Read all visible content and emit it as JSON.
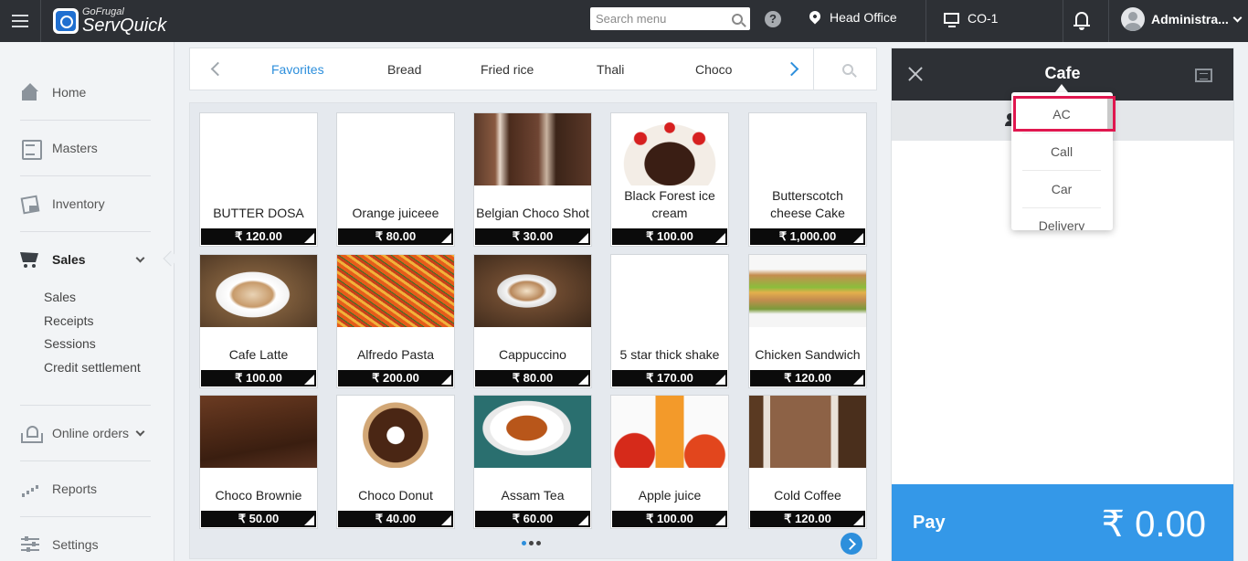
{
  "topbar": {
    "brand_small": "GoFrugal",
    "brand_name": "ServQuick",
    "search_placeholder": "Search menu",
    "help_label": "?",
    "location": "Head Office",
    "counter": "CO-1",
    "user": "Administra..."
  },
  "sidebar": {
    "home": "Home",
    "masters": "Masters",
    "inventory": "Inventory",
    "sales": "Sales",
    "sales_sub": [
      "Sales",
      "Receipts",
      "Sessions",
      "Credit settlement"
    ],
    "online_orders": "Online orders",
    "reports": "Reports",
    "settings": "Settings"
  },
  "categories": [
    "Favorites",
    "Bread",
    "Fried rice",
    "Thali",
    "Choco"
  ],
  "active_category": "Favorites",
  "products": [
    {
      "name": "BUTTER DOSA",
      "price": "₹ 120.00",
      "image": "none"
    },
    {
      "name": "Orange juiceee",
      "price": "₹ 80.00",
      "image": "none"
    },
    {
      "name": "Belgian Choco Shot",
      "price": "₹ 30.00",
      "image": "choco-shot"
    },
    {
      "name": "Black Forest ice cream",
      "price": "₹ 100.00",
      "image": "black-forest"
    },
    {
      "name": "Butterscotch cheese Cake",
      "price": "₹ 1,000.00",
      "image": "none"
    },
    {
      "name": "Cafe Latte",
      "price": "₹ 100.00",
      "image": "latte"
    },
    {
      "name": "Alfredo Pasta",
      "price": "₹ 200.00",
      "image": "pasta"
    },
    {
      "name": "Cappuccino",
      "price": "₹ 80.00",
      "image": "cappuccino"
    },
    {
      "name": "5 star thick shake",
      "price": "₹ 170.00",
      "image": "none"
    },
    {
      "name": "Chicken Sandwich",
      "price": "₹ 120.00",
      "image": "sandwich"
    },
    {
      "name": "Choco Brownie",
      "price": "₹ 50.00",
      "image": "brownie"
    },
    {
      "name": "Choco Donut",
      "price": "₹ 40.00",
      "image": "donut"
    },
    {
      "name": "Assam Tea",
      "price": "₹ 60.00",
      "image": "tea"
    },
    {
      "name": "Apple juice",
      "price": "₹ 100.00",
      "image": "apple-juice"
    },
    {
      "name": "Cold Coffee",
      "price": "₹ 120.00",
      "image": "cold-coffee"
    }
  ],
  "pager": {
    "pages": 3,
    "current": 1
  },
  "order": {
    "title": "Cafe",
    "sub_text_partial": "r",
    "pay_label": "Pay",
    "pay_amount": "₹ 0.00"
  },
  "order_type_dropdown": {
    "options": [
      "AC",
      "Call",
      "Car",
      "Delivery"
    ],
    "highlighted": "AC"
  },
  "colors": {
    "topbar_bg": "#2d3035",
    "accent_blue": "#2d8fdc",
    "pay_blue": "#3498e8",
    "highlight_red": "#e0174f",
    "price_bg": "#0b0b0b"
  }
}
